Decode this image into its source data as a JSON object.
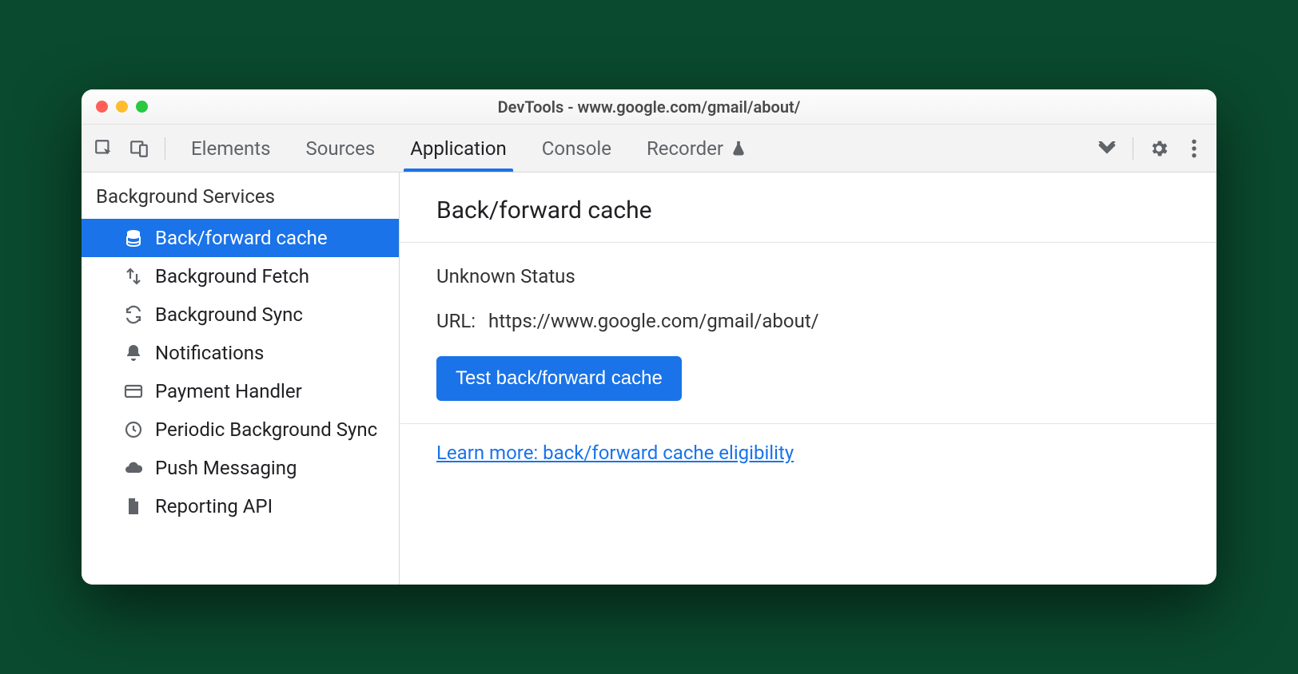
{
  "window": {
    "title": "DevTools - www.google.com/gmail/about/"
  },
  "tabs": {
    "items": [
      "Elements",
      "Sources",
      "Application",
      "Console",
      "Recorder"
    ],
    "active": "Application"
  },
  "sidebar": {
    "header": "Background Services",
    "items": [
      {
        "label": "Back/forward cache",
        "icon": "database-icon",
        "selected": true
      },
      {
        "label": "Background Fetch",
        "icon": "fetch-icon",
        "selected": false
      },
      {
        "label": "Background Sync",
        "icon": "sync-icon",
        "selected": false
      },
      {
        "label": "Notifications",
        "icon": "bell-icon",
        "selected": false
      },
      {
        "label": "Payment Handler",
        "icon": "card-icon",
        "selected": false
      },
      {
        "label": "Periodic Background Sync",
        "icon": "clock-icon",
        "selected": false
      },
      {
        "label": "Push Messaging",
        "icon": "cloud-icon",
        "selected": false
      },
      {
        "label": "Reporting API",
        "icon": "file-icon",
        "selected": false
      }
    ]
  },
  "main": {
    "heading": "Back/forward cache",
    "status": "Unknown Status",
    "url_label": "URL:",
    "url_value": "https://www.google.com/gmail/about/",
    "button": "Test back/forward cache",
    "learn_more": "Learn more: back/forward cache eligibility"
  }
}
